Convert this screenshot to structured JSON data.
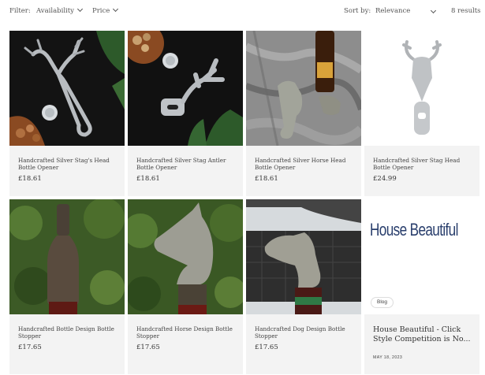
{
  "filter": {
    "label": "Filter:",
    "availability_label": "Availability",
    "price_label": "Price",
    "sort_label": "Sort by:",
    "sort_value": "Relevance",
    "results_count": "8 results"
  },
  "products": [
    {
      "title": "Handcrafted Silver Stag's Head Bottle Opener",
      "price": "£18.61"
    },
    {
      "title": "Handcrafted Silver Stag Antler Bottle Opener",
      "price": "£18.61"
    },
    {
      "title": "Handcrafted Silver Horse Head Bottle Opener",
      "price": "£18.61"
    },
    {
      "title": "Handcrafted Silver Stag Head Bottle Opener",
      "price": "£24.99"
    },
    {
      "title": "Handcrafted Bottle Design Bottle Stopper",
      "price": "£17.65"
    },
    {
      "title": "Handcrafted Horse Design Bottle Stopper",
      "price": "£17.65"
    },
    {
      "title": "Handcrafted Dog Design Bottle Stopper",
      "price": "£17.65"
    }
  ],
  "blog": {
    "logo_text": "House Beautiful",
    "badge": "Blog",
    "title": "House Beautiful - Click Style Competition is No...",
    "date": "MAY 18, 2023"
  },
  "colors": {
    "card_bg": "#f3f3f3",
    "logo_blue": "#2a3f6d"
  }
}
